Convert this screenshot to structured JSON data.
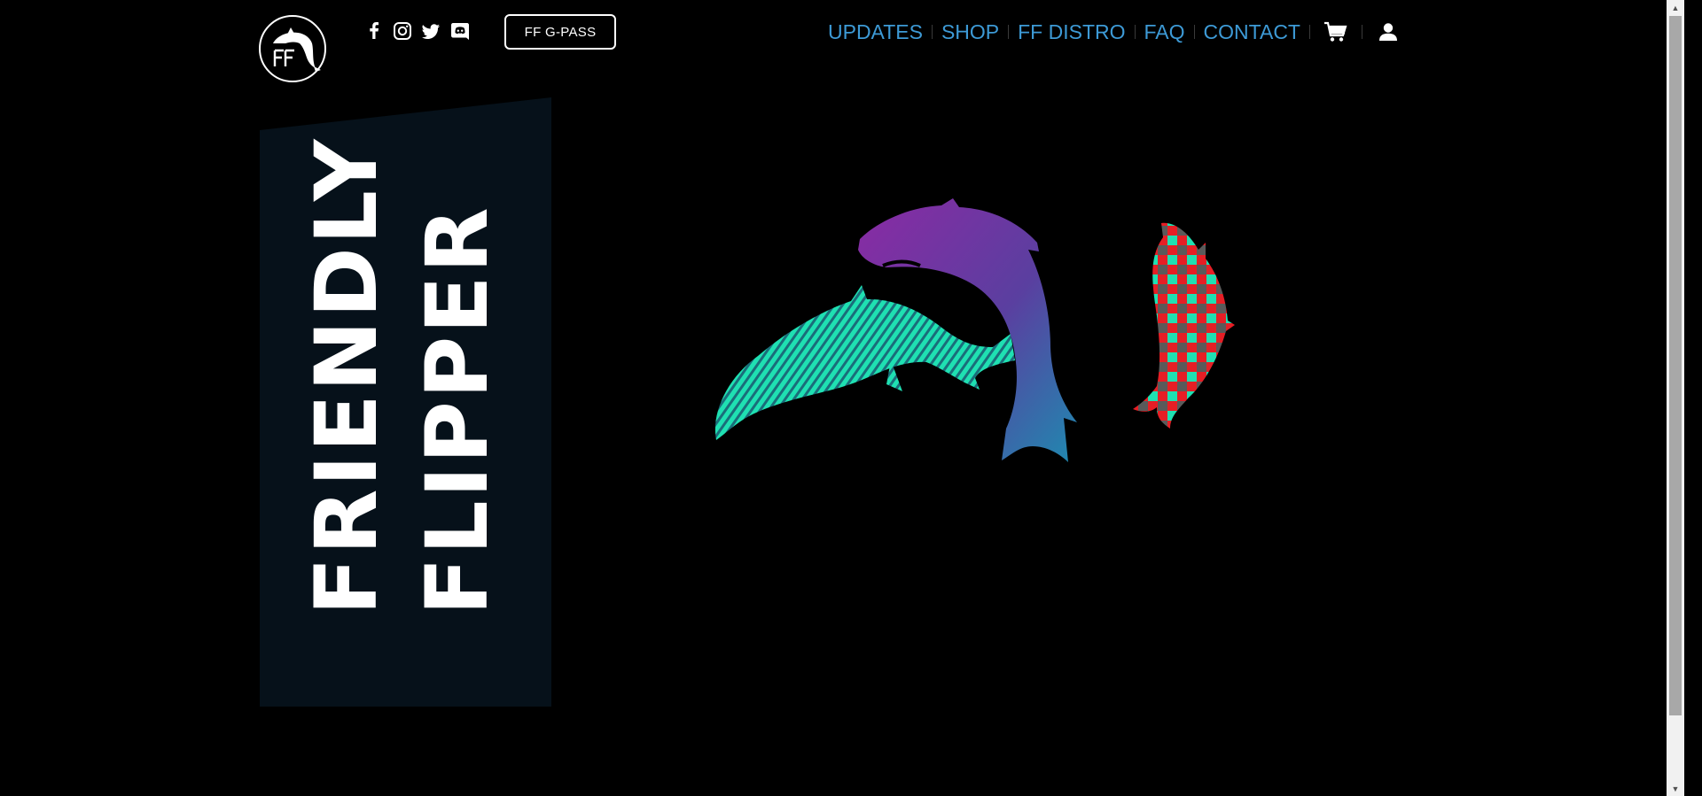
{
  "header": {
    "logo_icon": "ff-dolphin-logo-icon",
    "social": [
      {
        "name": "facebook-icon"
      },
      {
        "name": "instagram-icon"
      },
      {
        "name": "twitter-icon"
      },
      {
        "name": "discord-icon"
      }
    ],
    "gpass_label": "FF G-PASS",
    "nav": {
      "items": [
        "UPDATES",
        "SHOP",
        "FF DISTRO",
        "FAQ",
        "CONTACT"
      ],
      "cart_icon": "cart-icon",
      "account_icon": "user-icon"
    }
  },
  "hero": {
    "title_line1": "FRIENDLY",
    "title_line2": "FLIPPER"
  },
  "colors": {
    "nav_link": "#3d9ad6",
    "banner_bg": "#06111a",
    "page_bg": "#000000"
  }
}
